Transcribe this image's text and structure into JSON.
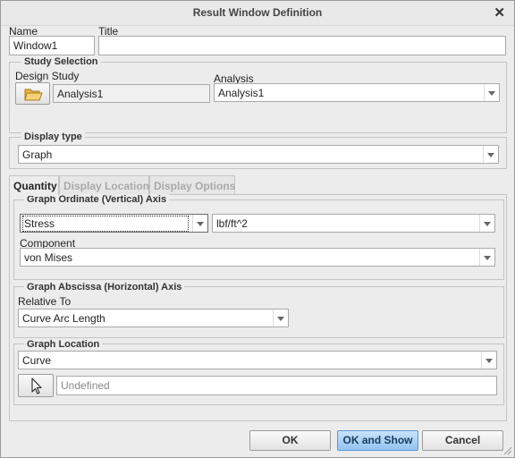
{
  "window": {
    "title": "Result Window Definition"
  },
  "fields": {
    "name_label": "Name",
    "name_value": "Window1",
    "title_label": "Title",
    "title_value": ""
  },
  "study_selection": {
    "group_label": "Study Selection",
    "design_study_label": "Design Study",
    "design_study_value": "Analysis1",
    "analysis_label": "Analysis",
    "analysis_value": "Analysis1"
  },
  "display_type": {
    "group_label": "Display type",
    "value": "Graph"
  },
  "tabs": [
    {
      "label": "Quantity",
      "active": true
    },
    {
      "label": "Display Location",
      "active": false
    },
    {
      "label": "Display Options",
      "active": false
    }
  ],
  "ordinate": {
    "group_label": "Graph Ordinate (Vertical) Axis",
    "quantity_value": "Stress",
    "units_value": "lbf/ft^2",
    "component_label": "Component",
    "component_value": "von Mises"
  },
  "abscissa": {
    "group_label": "Graph Abscissa (Horizontal) Axis",
    "relative_to_label": "Relative To",
    "relative_to_value": "Curve Arc Length"
  },
  "location": {
    "group_label": "Graph Location",
    "type_value": "Curve",
    "reference_placeholder": "Undefined"
  },
  "buttons": {
    "ok": "OK",
    "ok_and_show": "OK and Show",
    "cancel": "Cancel"
  },
  "icons": {
    "close": "close-icon",
    "open_folder": "open-folder-icon",
    "select_arrow": "cursor-arrow-icon",
    "dropdown": "chevron-down-icon",
    "resize": "resize-grip-icon"
  }
}
